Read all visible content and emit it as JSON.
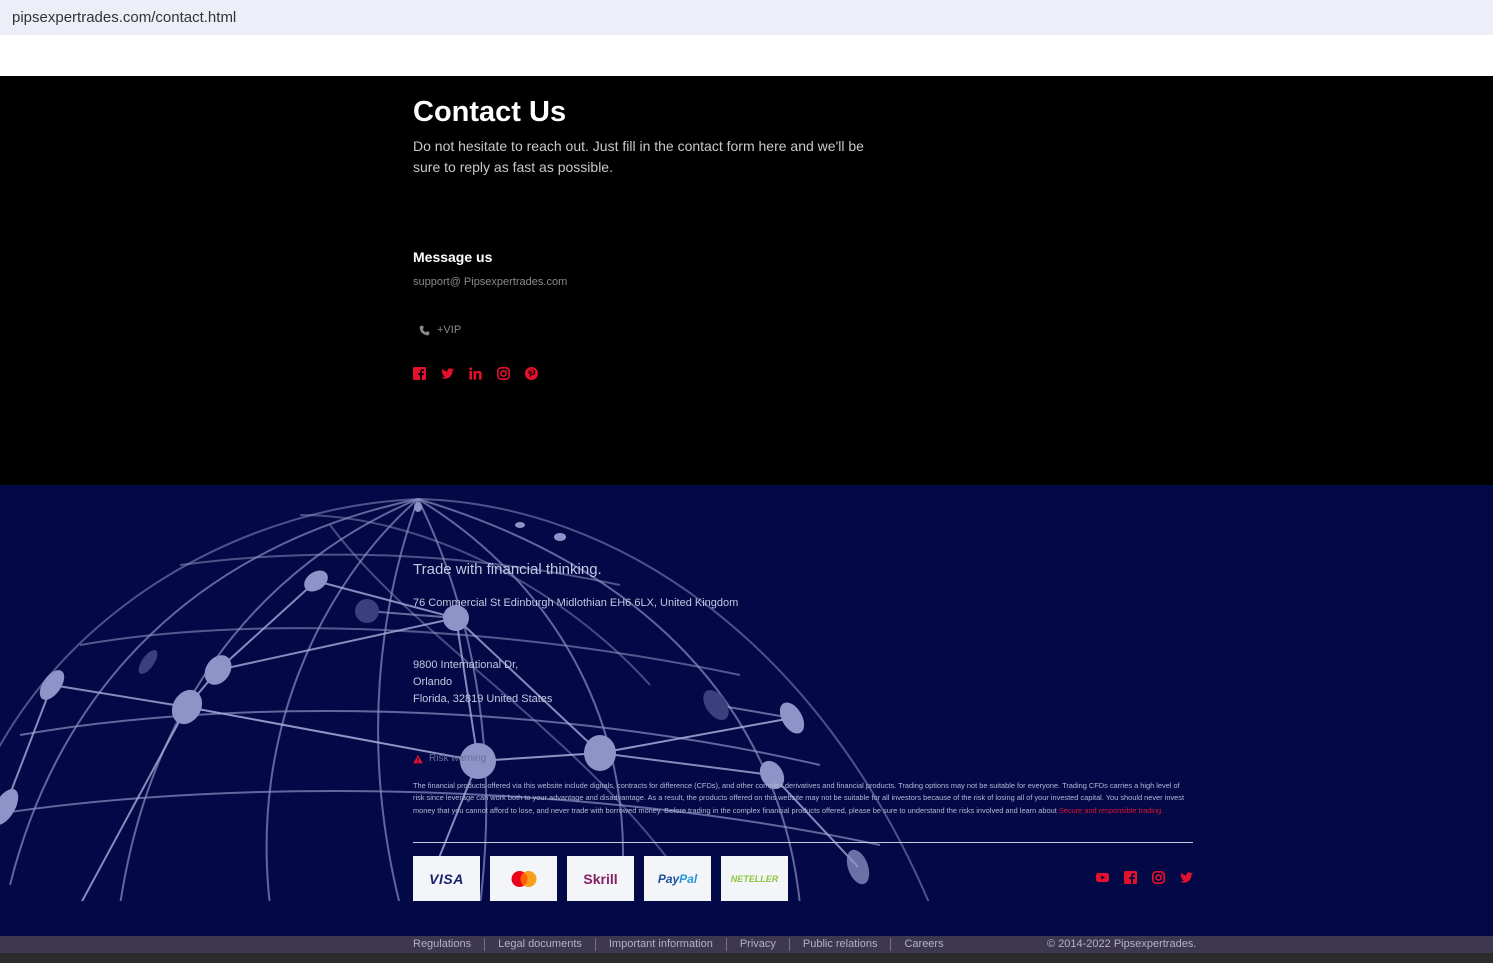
{
  "browser": {
    "url": "pipsexpertrades.com/contact.html"
  },
  "contact": {
    "title": "Contact Us",
    "description": "Do not hesitate to reach out. Just fill in the contact form here and we'll be sure to reply as fast as possible.",
    "message_title": "Message us",
    "email": "support@ Pipsexpertrades.com",
    "phone": "+VIP",
    "social_icons": [
      "facebook-icon",
      "twitter-icon",
      "linkedin-icon",
      "instagram-icon",
      "pinterest-icon"
    ]
  },
  "footer": {
    "tagline": "Trade with financial thinking.",
    "address_uk": "76 Commercial St Edinburgh Midlothian EH6 6LX, United Kingdom",
    "address_us_line1": "9800 International Dr,",
    "address_us_line2": "Orlando",
    "address_us_line3": "Florida, 32819 United States",
    "risk_label": "Risk warning",
    "risk_text": "The financial products offered via this website include digitals, contracts for difference (CFDs), and other complex derivatives and financial products. Trading options may not be suitable for everyone. Trading CFDs carries a high level of risk since leverage can work both to your advantage and disadvantage. As a result, the products offered on this website may not be suitable for all investors because of the risk of losing all of your invested capital. You should never invest money that you cannot afford to lose, and never trade with borrowed money. Before trading in the complex financial products offered, please be sure to understand the risks involved and learn about",
    "risk_link": "Secure and responsible trading.",
    "payments": {
      "visa": "VISA",
      "skrill": "Skrill",
      "paypal_pay": "Pay",
      "paypal_pal": "Pal",
      "neteller": "NETELLER"
    },
    "social_icons": [
      "youtube-icon",
      "facebook-icon",
      "instagram-icon",
      "twitter-icon"
    ]
  },
  "bottom_bar": {
    "links": [
      "Regulations",
      "Legal documents",
      "Important information",
      "Privacy",
      "Public relations",
      "Careers"
    ],
    "copyright": "© 2014-2022 Pipsexpertrades."
  },
  "colors": {
    "accent": "#e3112b",
    "footer_bg": "#020946",
    "bottom_bar_bg": "#3d3751"
  }
}
